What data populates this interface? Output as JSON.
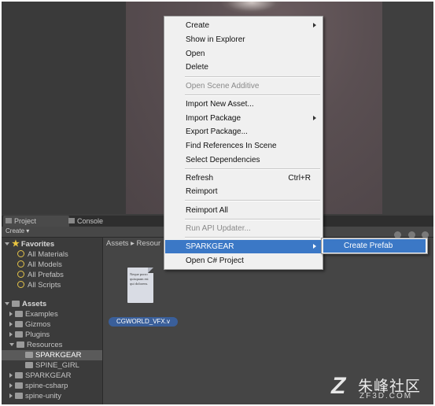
{
  "tabs": {
    "project": "Project",
    "console": "Console"
  },
  "toolbar": {
    "create": "Create"
  },
  "favorites": {
    "title": "Favorites",
    "items": [
      "All Materials",
      "All Models",
      "All Prefabs",
      "All Scripts"
    ]
  },
  "assets_tree": {
    "title": "Assets",
    "items": [
      "Examples",
      "Gizmos",
      "Plugins",
      "Resources",
      "SPARKGEAR",
      "SPINE_GIRL",
      "SPARKGEAR",
      "spine-csharp",
      "spine-unity"
    ]
  },
  "breadcrumb": "Assets ▸ Resour",
  "file": {
    "name": "CGWORLD_VFX.v",
    "preview_text": "Neque porro quisquam est qui dolorem."
  },
  "context_menu": {
    "create": "Create",
    "show_in_explorer": "Show in Explorer",
    "open": "Open",
    "delete": "Delete",
    "open_scene_additive": "Open Scene Additive",
    "import_new_asset": "Import New Asset...",
    "import_package": "Import Package",
    "export_package": "Export Package...",
    "find_references": "Find References In Scene",
    "select_dependencies": "Select Dependencies",
    "refresh": "Refresh",
    "refresh_shortcut": "Ctrl+R",
    "reimport": "Reimport",
    "reimport_all": "Reimport All",
    "run_api_updater": "Run API Updater...",
    "sparkgear": "SPARKGEAR",
    "open_csharp_project": "Open C# Project"
  },
  "submenu": {
    "create_prefab": "Create Prefab"
  },
  "watermark": {
    "chinese": "朱峰社区",
    "domain": "ZF3D.COM"
  },
  "colors": {
    "highlight": "#3b78c6",
    "menu_bg": "#f0f0f0",
    "panel_bg": "#3d3d3d",
    "favorite_star": "#e8c440"
  }
}
